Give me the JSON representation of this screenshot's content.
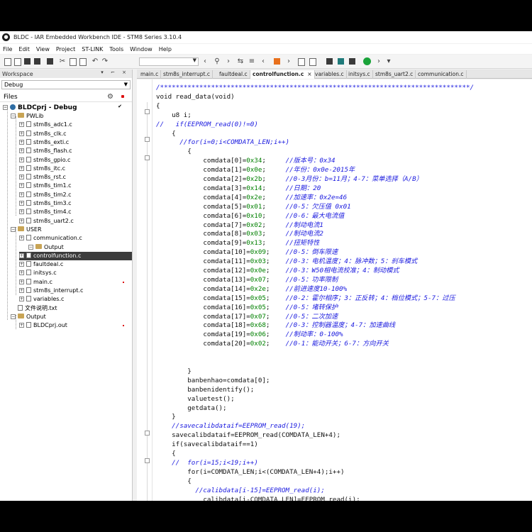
{
  "window": {
    "title": "BLDC - IAR Embedded Workbench IDE - STM8 Series 3.10.4"
  },
  "menu": [
    "File",
    "Edit",
    "View",
    "Project",
    "ST-LINK",
    "Tools",
    "Window",
    "Help"
  ],
  "workspace": {
    "header": "Workspace",
    "config": "Debug",
    "files_label": "Files",
    "project": "BLDCprj - Debug",
    "tree": [
      {
        "label": "PWLib",
        "kind": "folder"
      },
      {
        "label": "stm8s_adc1.c",
        "kind": "file"
      },
      {
        "label": "stm8s_clk.c",
        "kind": "file"
      },
      {
        "label": "stm8s_exti.c",
        "kind": "file"
      },
      {
        "label": "stm8s_flash.c",
        "kind": "file"
      },
      {
        "label": "stm8s_gpio.c",
        "kind": "file"
      },
      {
        "label": "stm8s_itc.c",
        "kind": "file"
      },
      {
        "label": "stm8s_rst.c",
        "kind": "file"
      },
      {
        "label": "stm8s_tim1.c",
        "kind": "file"
      },
      {
        "label": "stm8s_tim2.c",
        "kind": "file"
      },
      {
        "label": "stm8s_tim3.c",
        "kind": "file"
      },
      {
        "label": "stm8s_tim4.c",
        "kind": "file"
      },
      {
        "label": "stm8s_uart2.c",
        "kind": "file"
      },
      {
        "label": "USER",
        "kind": "folder"
      },
      {
        "label": "communication.c",
        "kind": "file"
      },
      {
        "label": "Output",
        "kind": "folder"
      },
      {
        "label": "controlfunction.c",
        "kind": "file",
        "selected": true
      },
      {
        "label": "faultdeal.c",
        "kind": "file"
      },
      {
        "label": "initsys.c",
        "kind": "file"
      },
      {
        "label": "main.c",
        "kind": "file"
      },
      {
        "label": "stm8s_interrupt.c",
        "kind": "file"
      },
      {
        "label": "variables.c",
        "kind": "file"
      },
      {
        "label": "文件说明.txt",
        "kind": "file"
      },
      {
        "label": "Output",
        "kind": "folder"
      },
      {
        "label": "BLDCprj.out",
        "kind": "file"
      }
    ]
  },
  "tabs": [
    {
      "label": "main.c"
    },
    {
      "label": "stm8s_interrupt.c"
    },
    {
      "label": "faultdeal.c"
    },
    {
      "label": "controlfunction.c",
      "active": true
    },
    {
      "label": "variables.c"
    },
    {
      "label": "initsys.c"
    },
    {
      "label": "stm8s_uart2.c"
    },
    {
      "label": "communication.c"
    }
  ],
  "code": [
    {
      "c": "/*******************************************************************************/"
    },
    {
      "t": "void read_data(void)"
    },
    {
      "t": "{"
    },
    {
      "t": "    u8 i;"
    },
    {
      "c": "//   if(EEPROM_read(0)!=0)"
    },
    {
      "t": "    {"
    },
    {
      "c": "      //for(i=0;i<COMDATA_LEN;i++)"
    },
    {
      "t": "        {"
    },
    {
      "t": "            comdata[0]=",
      "n": "0x34",
      "s": ";     ",
      "c": "//版本号：0x34"
    },
    {
      "t": "            comdata[1]=",
      "n": "0x0e",
      "s": ";     ",
      "c": "//年份：0x0e-2015年"
    },
    {
      "t": "            comdata[2]=",
      "n": "0x2b",
      "s": ";     ",
      "c": "//0-3月份：b=11月；4-7：菜单选择（A/B）"
    },
    {
      "t": "            comdata[3]=",
      "n": "0x14",
      "s": ";     ",
      "c": "//日期：20"
    },
    {
      "t": "            comdata[4]=",
      "n": "0x2e",
      "s": ";     ",
      "c": "//加速率：0x2e=46"
    },
    {
      "t": "            comdata[5]=",
      "n": "0x01",
      "s": ";     ",
      "c": "//0-5：欠压值 0x01"
    },
    {
      "t": "            comdata[6]=",
      "n": "0x10",
      "s": ";     ",
      "c": "//0-6：最大电流值"
    },
    {
      "t": "            comdata[7]=",
      "n": "0x02",
      "s": ";     ",
      "c": "//制动电流1"
    },
    {
      "t": "            comdata[8]=",
      "n": "0x03",
      "s": ";     ",
      "c": "//制动电流2"
    },
    {
      "t": "            comdata[9]=",
      "n": "0x13",
      "s": ";     ",
      "c": "//扭矩特性"
    },
    {
      "t": "            comdata[10]=",
      "n": "0x09",
      "s": ";    ",
      "c": "//0-5：倒车限速"
    },
    {
      "t": "            comdata[11]=",
      "n": "0x03",
      "s": ";    ",
      "c": "//0-3：电机温度；4：脉冲数；5：刹车模式"
    },
    {
      "t": "            comdata[12]=",
      "n": "0x0e",
      "s": ";    ",
      "c": "//0-3：W50相电流校准；4：制动模式"
    },
    {
      "t": "            comdata[13]=",
      "n": "0x07",
      "s": ";    ",
      "c": "//0-5：功率限制"
    },
    {
      "t": "            comdata[14]=",
      "n": "0x2e",
      "s": ";    ",
      "c": "//前进速度10-100%"
    },
    {
      "t": "            comdata[15]=",
      "n": "0x05",
      "s": ";    ",
      "c": "//0-2：霍尔相序；3：正反转；4：档位模式；5-7：过压"
    },
    {
      "t": "            comdata[16]=",
      "n": "0x05",
      "s": ";    ",
      "c": "//0-5：堵转保护"
    },
    {
      "t": "            comdata[17]=",
      "n": "0x07",
      "s": ";    ",
      "c": "//0-5：二次加速"
    },
    {
      "t": "            comdata[18]=",
      "n": "0x68",
      "s": ";    ",
      "c": "//0-3：控制器温度；4-7：加速曲线"
    },
    {
      "t": "            comdata[19]=",
      "n": "0x06",
      "s": ";    ",
      "c": "//制动率：0-100%"
    },
    {
      "t": "            comdata[20]=",
      "n": "0x02",
      "s": ";    ",
      "c": "//0-1：能动开关；6-7：方向开关"
    },
    {
      "t": ""
    },
    {
      "t": ""
    },
    {
      "t": "        }"
    },
    {
      "t": "        banbenhao=comdata[0];"
    },
    {
      "t": "        banbenidentify();"
    },
    {
      "t": "        valuetest();"
    },
    {
      "t": "        getdata();"
    },
    {
      "t": "    }"
    },
    {
      "c": "    //savecalibdataif=EEPROM_read(19);"
    },
    {
      "t": "    savecalibdataif=EEPROM_read(COMDATA_LEN+4);"
    },
    {
      "t": "    if(savecalibdataif==1)"
    },
    {
      "t": "    {"
    },
    {
      "c": "    //  for(i=15;i<19;i++)"
    },
    {
      "t": "        for(i=COMDATA_LEN;i<(COMDATA_LEN+4);i++)"
    },
    {
      "t": "        {"
    },
    {
      "c": "          //calibdata[i-15]=EEPROM_read(i);"
    },
    {
      "t": "            calibdata[i-COMDATA_LEN]=EEPROM_read(i);"
    }
  ]
}
